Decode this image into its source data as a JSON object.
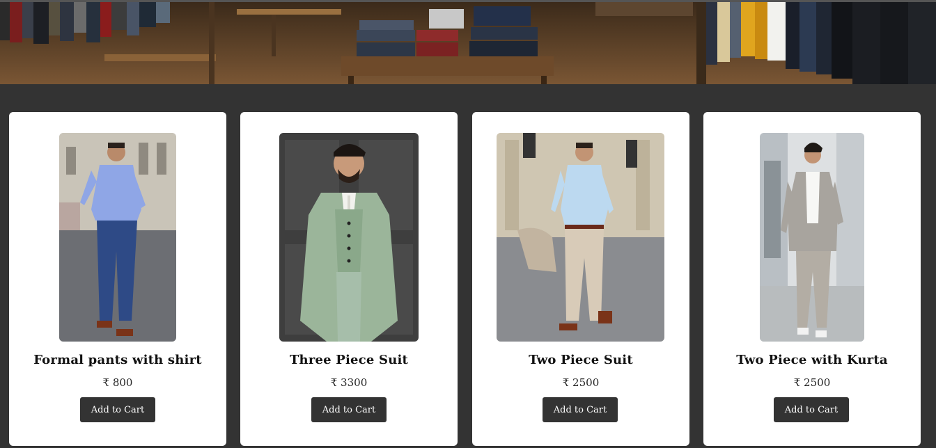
{
  "banner": {
    "image": "clothing-store-interior"
  },
  "products": [
    {
      "name": "Formal pants with shirt",
      "price": "₹ 800",
      "button": "Add to Cart",
      "image": "man-in-blue-shirt-and-navy-pants"
    },
    {
      "name": "Three Piece Suit",
      "price": "₹ 3300",
      "button": "Add to Cart",
      "image": "man-in-sage-green-three-piece-suit"
    },
    {
      "name": "Two Piece Suit",
      "price": "₹ 2500",
      "button": "Add to Cart",
      "image": "man-in-light-blue-shirt-and-beige-pants"
    },
    {
      "name": "Two Piece with Kurta",
      "price": "₹ 2500",
      "button": "Add to Cart",
      "image": "man-in-grey-suit-with-white-shirt"
    }
  ],
  "colors": {
    "page_bg": "#333333",
    "card_bg": "#ffffff",
    "button_bg": "#333333",
    "button_text": "#ffffff"
  }
}
